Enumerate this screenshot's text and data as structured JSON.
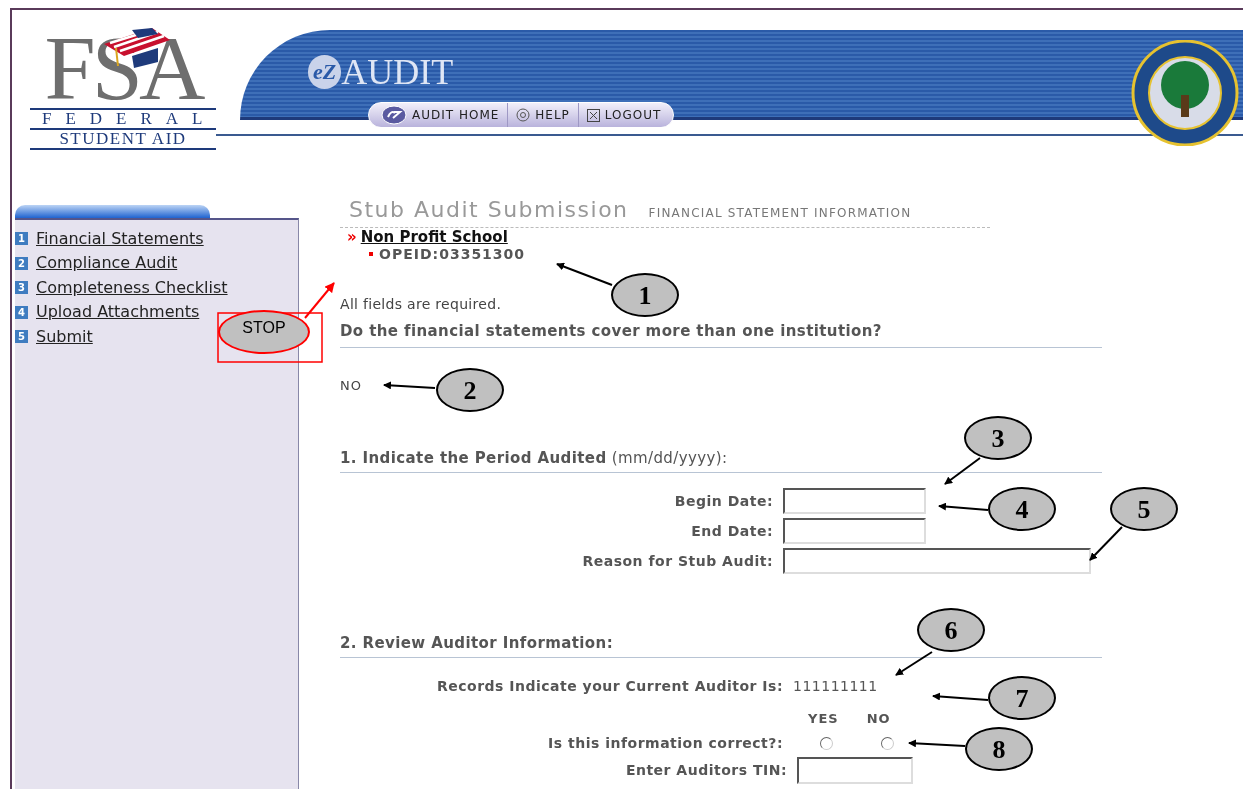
{
  "header": {
    "logo": {
      "letters": "FSA",
      "line1": "FEDERAL",
      "line2": "STUDENT AID"
    },
    "app_logo": {
      "badge": "eZ",
      "title": "AUDIT"
    },
    "nav": [
      {
        "kind": "home",
        "label": "AUDIT HOME"
      },
      {
        "kind": "help",
        "label": "HELP"
      },
      {
        "kind": "logout",
        "label": "LOGOUT"
      }
    ]
  },
  "sidebar": {
    "items": [
      {
        "number": "1",
        "label": "Financial Statements"
      },
      {
        "number": "2",
        "label": "Compliance Audit"
      },
      {
        "number": "3",
        "label": "Completeness Checklist"
      },
      {
        "number": "4",
        "label": "Upload Attachments"
      },
      {
        "number": "5",
        "label": "Submit"
      }
    ]
  },
  "main": {
    "title": "Stub Audit Submission",
    "subtitle": "FINANCIAL STATEMENT INFORMATION",
    "school_marker": "»",
    "school": "Non Profit School",
    "opeid": "OPEID:03351300",
    "note": "All fields are required.",
    "question": "Do the financial statements cover more than one institution?",
    "answer": "NO",
    "section1": {
      "title": "1. Indicate the Period Audited",
      "hint": "(mm/dd/yyyy):",
      "fields": [
        {
          "label": "Begin Date:",
          "kind": "date"
        },
        {
          "label": "End Date:",
          "kind": "date"
        },
        {
          "label": "Reason for Stub Audit:",
          "kind": "text"
        }
      ]
    },
    "section2": {
      "title": "2. Review Auditor Information:",
      "auditor_label": "Records Indicate your Current Auditor Is:",
      "auditor_value": "111111111",
      "question": "Is this information correct?:",
      "options": [
        {
          "label": "YES",
          "selected": false
        },
        {
          "label": "NO",
          "selected": false
        }
      ],
      "tin_label": "Enter Auditors TIN:"
    }
  },
  "annotations": {
    "stop": "STOP",
    "callouts": [
      "1",
      "2",
      "3",
      "4",
      "5",
      "6",
      "7",
      "8"
    ]
  }
}
